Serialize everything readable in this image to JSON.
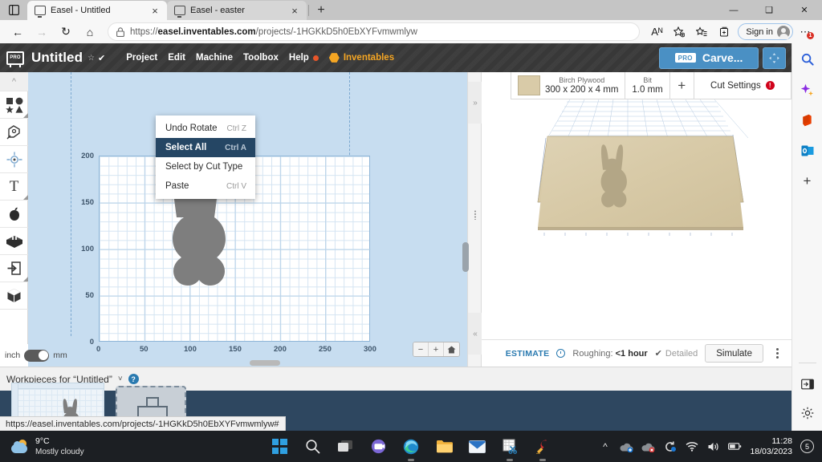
{
  "browser": {
    "tab_strip_icon": "tab-list-icon",
    "tabs": [
      {
        "title": "Easel - Untitled",
        "close": "×",
        "favicon": "easel-favicon"
      },
      {
        "title": "Easel - easter",
        "close": "×",
        "favicon": "easel-favicon"
      }
    ],
    "new_tab": "+",
    "window_controls": {
      "minimize": "—",
      "maximize": "❑",
      "close": "✕"
    },
    "nav": {
      "back": "←",
      "forward": "→",
      "reload": "↻",
      "home": "⌂"
    },
    "url_prefix": "https://",
    "url_domain": "easel.inventables.com",
    "url_path": "/projects/-1HGKkD5h0EbXYFvmwmlyw",
    "lock_icon": "lock-icon",
    "toolbar_icons": {
      "read_aloud": "Aᴺ",
      "favorite": "star-plus-icon",
      "favorites_list": "favorites-icon",
      "collections": "collections-icon",
      "more": "⋯"
    },
    "sign_in": "Sign in",
    "more_badge": "1"
  },
  "easel": {
    "logo_text": "PRO",
    "project_title": "Untitled",
    "title_star": "☆",
    "title_check": "✔",
    "menus": [
      "Project",
      "Edit",
      "Machine",
      "Toolbox",
      "Help"
    ],
    "inventables": "Inventables",
    "carve": {
      "pro": "PRO",
      "label": "Carve..."
    },
    "fit_button": "fullscreen-icon",
    "edit_menu": {
      "items": [
        {
          "label": "Undo Rotate",
          "shortcut": "Ctrl Z",
          "selected": false
        },
        {
          "label": "Select All",
          "shortcut": "Ctrl A",
          "selected": true
        },
        {
          "label": "Select by Cut Type",
          "shortcut": "",
          "selected": false
        },
        {
          "label": "Paste",
          "shortcut": "Ctrl V",
          "selected": false
        }
      ]
    },
    "tools": [
      {
        "name": "collapse-rail",
        "glyph": "»"
      },
      {
        "name": "shapes-tool",
        "glyph": "shapes"
      },
      {
        "name": "pen-tool",
        "glyph": "pen"
      },
      {
        "name": "center-tool",
        "glyph": "center"
      },
      {
        "name": "text-tool",
        "glyph": "T"
      },
      {
        "name": "apps-tool",
        "glyph": "apple"
      },
      {
        "name": "projects-tool",
        "glyph": "block"
      },
      {
        "name": "import-tool",
        "glyph": "import"
      },
      {
        "name": "three-d-tool",
        "glyph": "cube"
      }
    ],
    "units": {
      "left": "inch",
      "right": "mm",
      "selected": "mm"
    },
    "canvas": {
      "y_ticks": [
        "200",
        "150",
        "100",
        "50",
        "0"
      ],
      "x_ticks": [
        "0",
        "50",
        "100",
        "150",
        "200",
        "250",
        "300"
      ],
      "shape": "bunny-silhouette",
      "shape_color": "#7e7e7e",
      "zoom_out": "−",
      "zoom_in": "+",
      "zoom_home": "home-icon"
    },
    "material": {
      "swatch_color": "#d9cba8",
      "name_label": "Birch Plywood",
      "dimensions": "300 x 200 x 4 mm",
      "bit_label": "Bit",
      "bit_value": "1.0 mm",
      "add": "+",
      "cut_settings": "Cut Settings",
      "cut_settings_warning": "!"
    },
    "estimate": {
      "label": "ESTIMATE",
      "roughing_label": "Roughing:",
      "roughing_value": "<1 hour",
      "detailed": "Detailed",
      "detailed_check": "✔",
      "simulate": "Simulate",
      "more": "kebab-menu"
    },
    "workpieces": {
      "title": "Workpieces for “Untitled”",
      "caret": "˅",
      "help": "?",
      "add_label": "+"
    },
    "status_link": "https://easel.inventables.com/projects/-1HGKkD5h0EbXYFvmwmlyw#"
  },
  "edge_rail": {
    "icons": [
      "search-icon",
      "copilot-icon",
      "office-icon",
      "outlook-icon",
      "add-icon"
    ],
    "bottom_icons": [
      "sidebar-toggle-icon",
      "settings-gear-icon"
    ]
  },
  "taskbar": {
    "weather_temp": "9°C",
    "weather_desc": "Mostly cloudy",
    "apps": [
      "windows-start-icon",
      "search-icon",
      "task-view-icon",
      "teams-icon",
      "edge-icon",
      "file-explorer-icon",
      "mail-icon",
      "snipping-tool-icon",
      "ccleaner-icon"
    ],
    "tray": [
      "chevron-up-icon",
      "onedrive-icon",
      "antivirus-icon",
      "sync-icon",
      "wifi-icon",
      "volume-icon",
      "battery-icon"
    ],
    "time": "11:28",
    "date": "18/03/2023",
    "notification_count": "5"
  }
}
